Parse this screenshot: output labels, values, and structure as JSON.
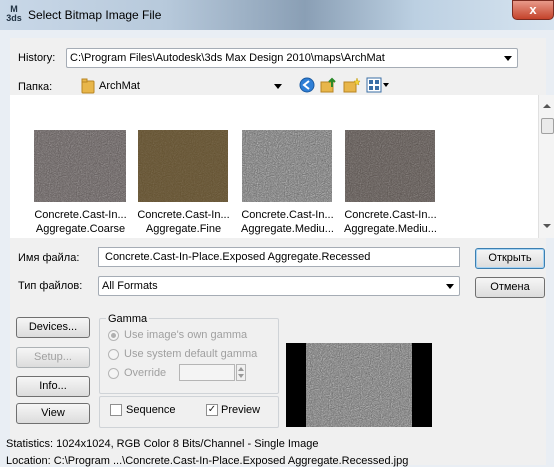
{
  "window": {
    "title": "Select Bitmap Image File",
    "app_icon_text": "M\n3ds",
    "close": "x"
  },
  "history": {
    "label": "History:",
    "value": "C:\\Program Files\\Autodesk\\3ds Max Design 2010\\maps\\ArchMat"
  },
  "folder": {
    "label": "Папка:",
    "value": "ArchMat"
  },
  "thumbnails": [
    {
      "line1": "Concrete.Cast-In...",
      "line2": "Aggregate.Coarse"
    },
    {
      "line1": "Concrete.Cast-In...",
      "line2": "Aggregate.Fine"
    },
    {
      "line1": "Concrete.Cast-In...",
      "line2": "Aggregate.Mediu..."
    },
    {
      "line1": "Concrete.Cast-In...",
      "line2": "Aggregate.Mediu..."
    }
  ],
  "filename": {
    "label": "Имя файла:",
    "value": "Concrete.Cast-In-Place.Exposed Aggregate.Recessed"
  },
  "filetype": {
    "label": "Тип файлов:",
    "value": "All Formats"
  },
  "buttons": {
    "open": "Открыть",
    "cancel": "Отмена",
    "devices": "Devices...",
    "setup": "Setup...",
    "info": "Info...",
    "view": "View"
  },
  "gamma": {
    "title": "Gamma",
    "own": "Use image's own gamma",
    "system": "Use system default gamma",
    "override": "Override"
  },
  "options": {
    "sequence": "Sequence",
    "preview": "Preview"
  },
  "status": {
    "statistics": "Statistics:  1024x1024, RGB Color 8 Bits/Channel - Single Image",
    "location": "Location:  C:\\Program ...\\Concrete.Cast-In-Place.Exposed Aggregate.Recessed.jpg"
  }
}
